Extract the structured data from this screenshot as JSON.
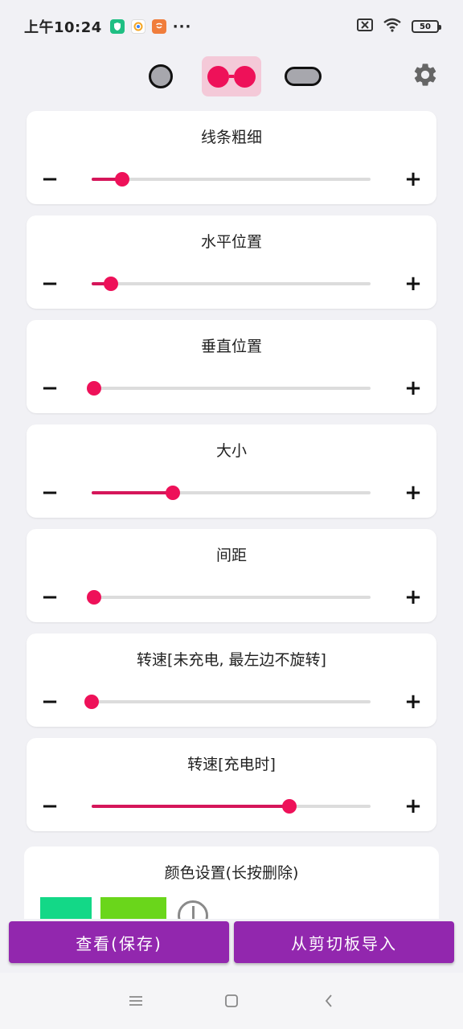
{
  "status_bar": {
    "time": "上午10:24",
    "dots": "···",
    "battery": "50"
  },
  "colors": {
    "accent": "#ee1159",
    "accent_fill": "#d5165a",
    "button": "#9227ae",
    "swatch_1": "#13d887",
    "swatch_2": "#6ad61b"
  },
  "sliders": [
    {
      "title": "线条粗细",
      "minus": "−",
      "plus": "+",
      "percent": 11
    },
    {
      "title": "水平位置",
      "minus": "−",
      "plus": "+",
      "percent": 7
    },
    {
      "title": "垂直位置",
      "minus": "−",
      "plus": "+",
      "percent": 1
    },
    {
      "title": "大小",
      "minus": "−",
      "plus": "+",
      "percent": 29
    },
    {
      "title": "间距",
      "minus": "−",
      "plus": "+",
      "percent": 1
    },
    {
      "title": "转速[未充电, 最左边不旋转]",
      "minus": "−",
      "plus": "+",
      "percent": 0
    },
    {
      "title": "转速[充电时]",
      "minus": "−",
      "plus": "+",
      "percent": 71
    }
  ],
  "color_settings": {
    "title": "颜色设置(长按删除)"
  },
  "bottom_buttons": {
    "view_save": "查看(保存)",
    "import_clipboard": "从剪切板导入"
  }
}
